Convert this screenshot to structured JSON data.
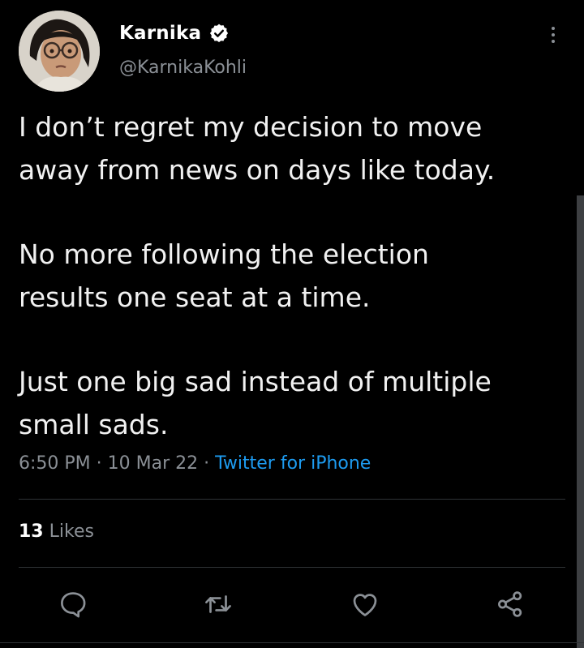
{
  "author": {
    "display_name": "Karnika",
    "handle": "@KarnikaKohli",
    "verified": true,
    "avatar_icon": "profile-photo"
  },
  "tweet": {
    "paragraphs": [
      "I don’t regret my decision to move\naway from news on days like today.",
      "No more following the election\nresults one seat at a time.",
      "Just one big sad instead of multiple\nsmall sads."
    ],
    "time": "6:50 PM",
    "separator": " · ",
    "date": "10 Mar 22",
    "source": "Twitter for iPhone"
  },
  "stats": {
    "likes_count": "13",
    "likes_label": " Likes"
  },
  "actions": [
    {
      "name": "reply",
      "icon": "speech-bubble-icon"
    },
    {
      "name": "retweet",
      "icon": "retweet-icon"
    },
    {
      "name": "like",
      "icon": "heart-icon"
    },
    {
      "name": "share",
      "icon": "share-nodes-icon"
    }
  ],
  "colors": {
    "background": "#000000",
    "text": "#e7e9ea",
    "secondary": "#8b9096",
    "link": "#1d9bf0",
    "divider": "#2f3336"
  }
}
